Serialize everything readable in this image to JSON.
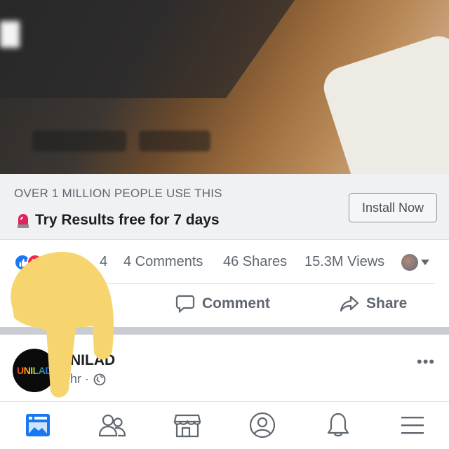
{
  "ad": {
    "kicker": "OVER 1 MILLION PEOPLE USE THIS",
    "title": "Try Results free for 7 days",
    "install_label": "Install Now"
  },
  "stats": {
    "reaction_count": "4",
    "comments": "4 Comments",
    "shares": "46 Shares",
    "views": "15.3M Views"
  },
  "actions": {
    "comment_label": "Comment",
    "share_label": "Share"
  },
  "next_post": {
    "page_name": "NILAD",
    "avatar_text": "UNILAD",
    "time": "hr ·"
  },
  "colors": {
    "brand_blue": "#1877f2",
    "love_red": "#f0284a",
    "text_primary": "#1c1e21",
    "text_secondary": "#606770",
    "finger_overlay": "#f7d56e"
  },
  "icons": {
    "tabs": [
      "news-feed-icon",
      "friends-icon",
      "marketplace-icon",
      "profile-icon",
      "notifications-icon",
      "menu-icon"
    ]
  }
}
